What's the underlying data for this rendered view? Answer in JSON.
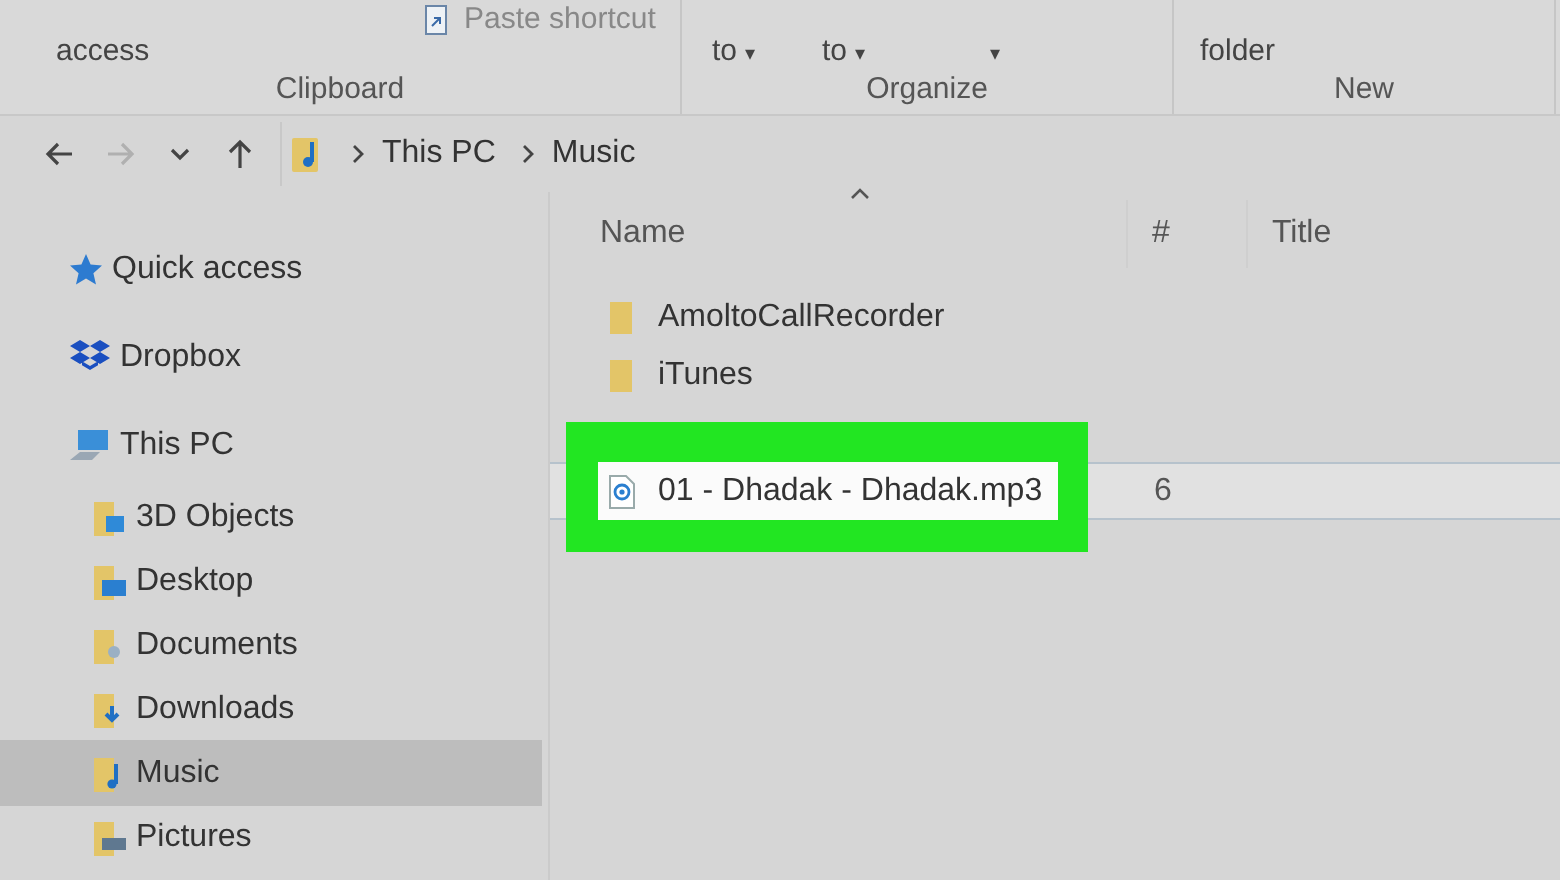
{
  "ribbon": {
    "groups": [
      {
        "label": "Clipboard",
        "buttons": [
          {
            "label": "access",
            "kind": "large",
            "disabled": false
          },
          {
            "label": "Paste shortcut",
            "kind": "small",
            "disabled": true
          }
        ]
      },
      {
        "label": "Organize",
        "buttons": [
          {
            "label": "to",
            "caret": "▾",
            "kind": "large",
            "disabled": false
          },
          {
            "label": "to",
            "caret": "▾",
            "kind": "large",
            "disabled": false
          },
          {
            "caret": "▾",
            "kind": "large",
            "disabled": false
          }
        ]
      },
      {
        "label": "New",
        "buttons": [
          {
            "label": "folder",
            "kind": "large",
            "disabled": false
          }
        ]
      }
    ]
  },
  "nav": [
    {
      "kind": "back",
      "disabled": false
    },
    {
      "kind": "forward",
      "disabled": true
    },
    {
      "kind": "recent",
      "disabled": false
    },
    {
      "kind": "up",
      "disabled": false
    }
  ],
  "breadcrumb": [
    "This PC",
    "Music"
  ],
  "sidebar": {
    "items": [
      {
        "label": "Quick access",
        "kind": "star",
        "selected": false
      },
      {
        "label": "Dropbox",
        "kind": "dropbox",
        "selected": false
      },
      {
        "label": "This PC",
        "kind": "pc",
        "selected": false,
        "children": [
          {
            "label": "3D Objects",
            "kind": "cube",
            "selected": false
          },
          {
            "label": "Desktop",
            "kind": "desktop",
            "selected": false
          },
          {
            "label": "Documents",
            "kind": "documents",
            "selected": false
          },
          {
            "label": "Downloads",
            "kind": "downloads",
            "selected": false
          },
          {
            "label": "Music",
            "kind": "music",
            "selected": true
          },
          {
            "label": "Pictures",
            "kind": "pictures",
            "selected": false
          }
        ]
      }
    ]
  },
  "files": {
    "columns": [
      {
        "label": "Name",
        "sorted": true
      },
      {
        "label": "#",
        "sorted": false
      },
      {
        "label": "Title",
        "sorted": false
      }
    ],
    "rows": [
      {
        "name": "AmoltoCallRecorder",
        "kind": "folder",
        "selected": false,
        "highlighted": false
      },
      {
        "name": "iTunes",
        "kind": "folder",
        "selected": false,
        "highlighted": false
      },
      {
        "name": "01 - Dhadak - Dhadak.mp3",
        "kind": "audio",
        "number": "6",
        "selected": true,
        "highlighted": true
      }
    ]
  }
}
